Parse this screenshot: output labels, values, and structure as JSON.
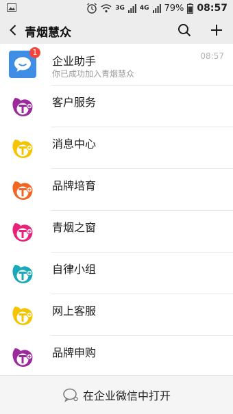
{
  "status_bar": {
    "battery_percent": "79%",
    "time": "08:57",
    "signal_labels": [
      "3G",
      "4G"
    ]
  },
  "nav": {
    "title": "青烟慧众"
  },
  "assistant": {
    "name": "企业助手",
    "subtitle": "你已成功加入青烟慧众",
    "time": "08:57",
    "badge": "1"
  },
  "items": [
    {
      "label": "客户服务",
      "color": "#9c2a9d"
    },
    {
      "label": "消息中心",
      "color": "#f5c400"
    },
    {
      "label": "品牌培育",
      "color": "#f26522"
    },
    {
      "label": "青烟之窗",
      "color": "#e7247a"
    },
    {
      "label": "自律小组",
      "color": "#1aa9b8"
    },
    {
      "label": "网上客服",
      "color": "#f5c400"
    },
    {
      "label": "品牌申购",
      "color": "#9c2a9d"
    }
  ],
  "bottom": {
    "open_label": "在企业微信中打开"
  }
}
